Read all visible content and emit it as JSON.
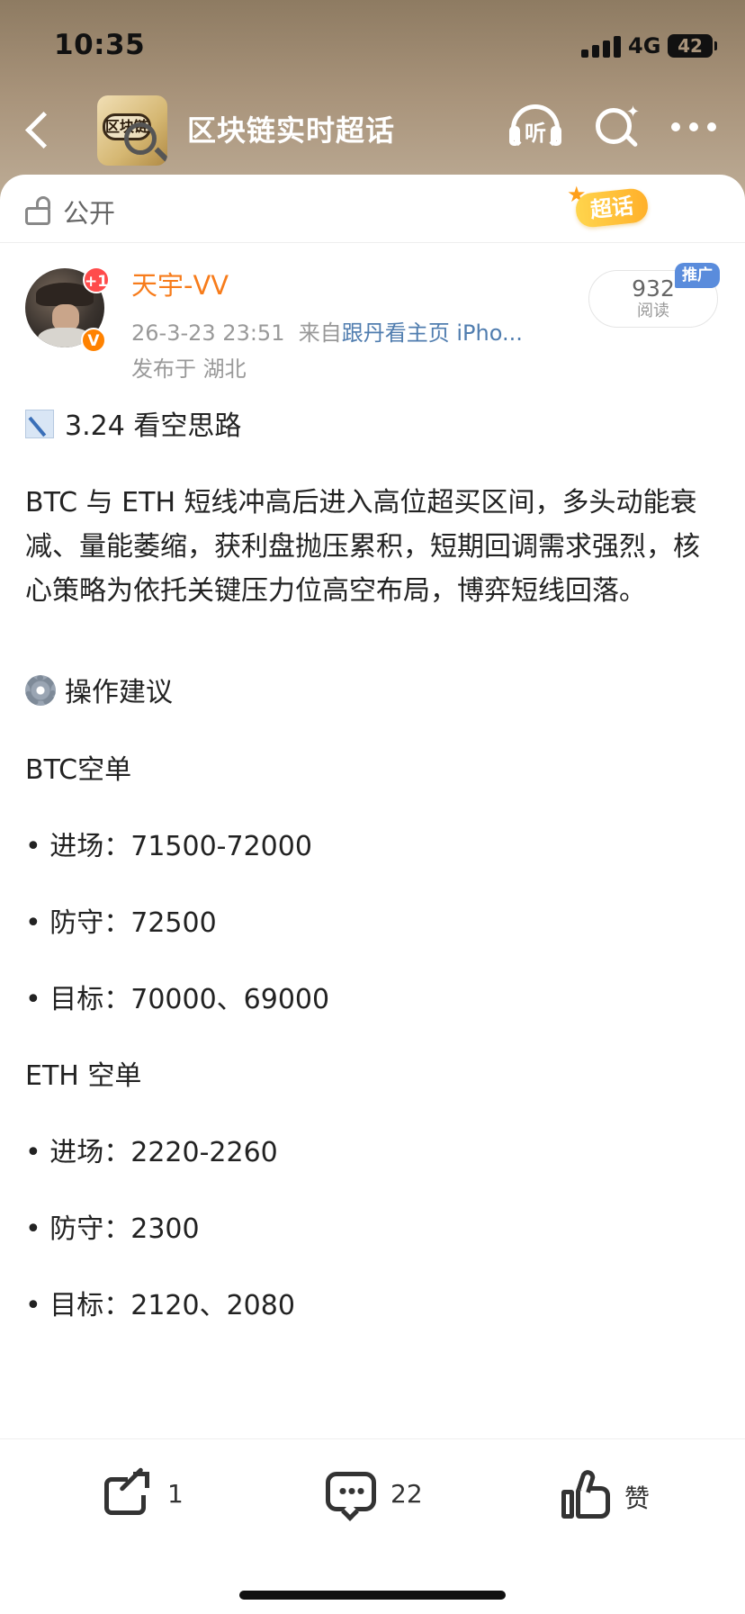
{
  "status_bar": {
    "time": "10:35",
    "network": "4G",
    "battery": "42"
  },
  "nav": {
    "topic_logo_text": "区块链",
    "title": "区块链实时超话",
    "listen_label": "听"
  },
  "visibility": {
    "label": "公开",
    "badge": "超话"
  },
  "author": {
    "name": "天宇-VV",
    "new_badge": "+1",
    "verified_mark": "V",
    "timestamp": "26-3-23 23:51",
    "source_prefix": "来自",
    "source": "跟丹看主页 iPho...",
    "location": "发布于 湖北",
    "read_count": "932",
    "read_label": "阅读",
    "promo_tag": "推广"
  },
  "post": {
    "heading": "3.24 看空思路",
    "summary": "BTC 与 ETH 短线冲高后进入高位超买区间，多头动能衰减、量能萎缩，获利盘抛压累积，短期回调需求强烈，核心策略为依托关键压力位高空布局，博弈短线回落。",
    "section_title": "操作建议",
    "btc_title": "BTC空单",
    "btc_entry": "• 进场：71500-72000",
    "btc_stop": "• 防守：72500",
    "btc_target": "• 目标：70000、69000",
    "eth_title": "ETH 空单",
    "eth_entry": "• 进场：2220-2260",
    "eth_stop": "• 防守：2300",
    "eth_target": "• 目标：2120、2080"
  },
  "toolbar": {
    "share_count": "1",
    "comment_count": "22",
    "like_label": "赞"
  },
  "colors": {
    "author_name": "#f77c1b",
    "source_link": "#507daf",
    "verified": "#ff8200",
    "promo": "#5a8cdc"
  }
}
